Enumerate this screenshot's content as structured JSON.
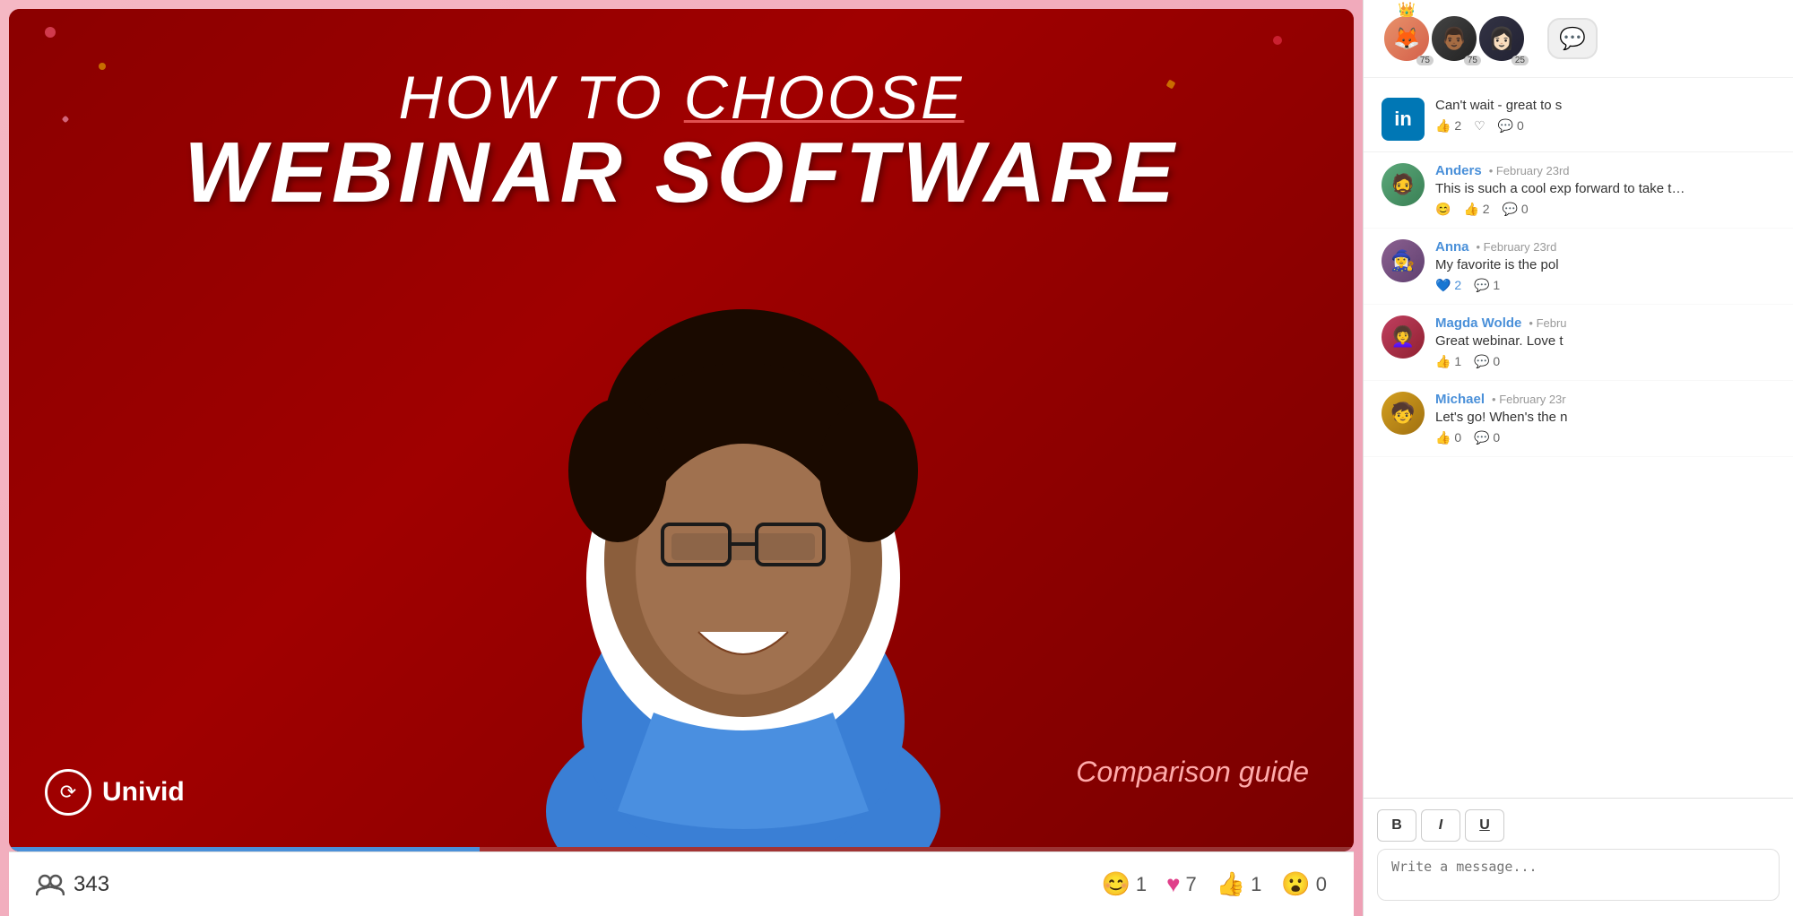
{
  "app": {
    "title": "How to Choose Webinar Software - Univid"
  },
  "video": {
    "title_line1": "HOW TO ",
    "title_choose": "CHOOSE",
    "title_line2": "WEBINAR SOFTWARE",
    "subtitle": "Comparison guide",
    "logo_text": "Univid",
    "viewers_count": "343",
    "reactions": [
      {
        "emoji": "😊",
        "count": "1"
      },
      {
        "emoji": "♥",
        "count": "7"
      },
      {
        "emoji": "👍",
        "count": "1"
      },
      {
        "emoji": "😮",
        "count": "0"
      }
    ],
    "progress_percent": 35
  },
  "chat": {
    "title": "Chat",
    "avatars": [
      {
        "color": "#e8916a",
        "label": "U1",
        "badge": "👑",
        "count": "75"
      },
      {
        "color": "#555",
        "label": "U2",
        "count": "75"
      },
      {
        "color": "#334",
        "label": "U3",
        "count": "25"
      }
    ],
    "messages": [
      {
        "id": "msg-linkedin",
        "platform": "linkedin",
        "avatar_bg": "#0077b5",
        "avatar_label": "in",
        "name": "",
        "time": "",
        "text": "Can't wait - great to s",
        "reactions": [
          {
            "emoji": "👍",
            "count": "2"
          },
          {
            "emoji": "♡",
            "count": ""
          },
          {
            "emoji": "💬",
            "count": "0"
          }
        ]
      },
      {
        "id": "msg-anders",
        "avatar_bg": "#5ba87a",
        "avatar_label": "A",
        "avatar_emoji": "🧔",
        "name": "Anders",
        "time": "• February 23rd",
        "text": "This is such a cool exp forward to take the n",
        "reactions": [
          {
            "emoji": "😊",
            "count": ""
          },
          {
            "emoji": "👍",
            "count": "2"
          },
          {
            "emoji": "💬",
            "count": "0"
          }
        ]
      },
      {
        "id": "msg-anna",
        "avatar_bg": "#8b6090",
        "avatar_label": "An",
        "avatar_emoji": "🧙‍♀️",
        "name": "Anna",
        "time": "• February 23rd",
        "text": "My favorite is the pol",
        "reactions": [
          {
            "emoji": "💙",
            "count": "2"
          },
          {
            "emoji": "💬",
            "count": "1"
          }
        ]
      },
      {
        "id": "msg-magda",
        "avatar_bg": "#c04060",
        "avatar_label": "M",
        "avatar_emoji": "👩‍🦱",
        "name": "Magda Wolde",
        "time": "• Febru",
        "text": "Great webinar. Love t",
        "reactions": [
          {
            "emoji": "👍",
            "count": "1"
          },
          {
            "emoji": "💬",
            "count": "0"
          }
        ]
      },
      {
        "id": "msg-michael",
        "avatar_bg": "#d4a020",
        "avatar_label": "Mi",
        "avatar_emoji": "🧒",
        "name": "Michael",
        "time": "• February 23r",
        "text": "Let's go! When's the n",
        "reactions": [
          {
            "emoji": "👍",
            "count": "0"
          },
          {
            "emoji": "💬",
            "count": "0"
          }
        ]
      }
    ],
    "toolbar_buttons": [
      "B",
      "I",
      "U"
    ],
    "input_placeholder": "Write a message..."
  }
}
